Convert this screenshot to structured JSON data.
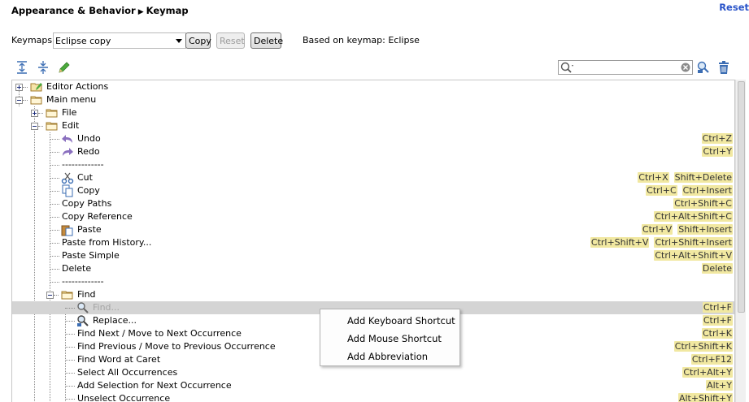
{
  "breadcrumb": {
    "parent": "Appearance & Behavior",
    "current": "Keymap"
  },
  "reset_label": "Reset",
  "keymap": {
    "label": "Keymaps:",
    "selected": "Eclipse copy",
    "copy_label": "Copy",
    "reset_label": "Reset",
    "delete_label": "Delete",
    "based_on": "Based on keymap: Eclipse"
  },
  "search": {
    "value": ""
  },
  "tree": [
    {
      "label": "Editor Actions",
      "depth": 0,
      "icon": "editor-actions-icon",
      "toggle": "plus",
      "shortcuts": []
    },
    {
      "label": "Main menu",
      "depth": 0,
      "icon": "folder-icon",
      "toggle": "minus",
      "shortcuts": []
    },
    {
      "label": "File",
      "depth": 1,
      "icon": "folder-icon",
      "toggle": "plus",
      "shortcuts": []
    },
    {
      "label": "Edit",
      "depth": 1,
      "icon": "folder-icon",
      "toggle": "minus",
      "shortcuts": []
    },
    {
      "label": "Undo",
      "depth": 2,
      "icon": "undo-icon",
      "shortcuts": [
        "Ctrl+Z"
      ]
    },
    {
      "label": "Redo",
      "depth": 2,
      "icon": "redo-icon",
      "shortcuts": [
        "Ctrl+Y"
      ]
    },
    {
      "label": "-------------",
      "depth": 2,
      "icon": "",
      "shortcuts": []
    },
    {
      "label": "Cut",
      "depth": 2,
      "icon": "scissors-icon",
      "shortcuts": [
        "Ctrl+X",
        "Shift+Delete"
      ]
    },
    {
      "label": "Copy",
      "depth": 2,
      "icon": "copy-icon",
      "shortcuts": [
        "Ctrl+C",
        "Ctrl+Insert"
      ]
    },
    {
      "label": "Copy Paths",
      "depth": 2,
      "icon": "",
      "shortcuts": [
        "Ctrl+Shift+C"
      ]
    },
    {
      "label": "Copy Reference",
      "depth": 2,
      "icon": "",
      "shortcuts": [
        "Ctrl+Alt+Shift+C"
      ]
    },
    {
      "label": "Paste",
      "depth": 2,
      "icon": "paste-icon",
      "shortcuts": [
        "Ctrl+V",
        "Shift+Insert"
      ]
    },
    {
      "label": "Paste from History...",
      "depth": 2,
      "icon": "",
      "shortcuts": [
        "Ctrl+Shift+V",
        "Ctrl+Shift+Insert"
      ]
    },
    {
      "label": "Paste Simple",
      "depth": 2,
      "icon": "",
      "shortcuts": [
        "Ctrl+Alt+Shift+V"
      ]
    },
    {
      "label": "Delete",
      "depth": 2,
      "icon": "",
      "shortcuts": [
        "Delete"
      ]
    },
    {
      "label": "-------------",
      "depth": 2,
      "icon": "",
      "shortcuts": []
    },
    {
      "label": "Find",
      "depth": 2,
      "icon": "folder-icon",
      "toggle": "minus",
      "shortcuts": []
    },
    {
      "label": "Find...",
      "depth": 3,
      "icon": "find-icon",
      "shortcuts": [
        "Ctrl+F"
      ],
      "selected": true
    },
    {
      "label": "Replace...",
      "depth": 3,
      "icon": "replace-icon",
      "shortcuts": [
        "Ctrl+F"
      ]
    },
    {
      "label": "Find Next / Move to Next Occurrence",
      "depth": 3,
      "icon": "",
      "shortcuts": [
        "Ctrl+K"
      ]
    },
    {
      "label": "Find Previous / Move to Previous Occurrence",
      "depth": 3,
      "icon": "",
      "shortcuts": [
        "Ctrl+Shift+K"
      ]
    },
    {
      "label": "Find Word at Caret",
      "depth": 3,
      "icon": "",
      "shortcuts": [
        "Ctrl+F12"
      ]
    },
    {
      "label": "Select All Occurrences",
      "depth": 3,
      "icon": "",
      "shortcuts": [
        "Ctrl+Alt+Y"
      ]
    },
    {
      "label": "Add Selection for Next Occurrence",
      "depth": 3,
      "icon": "",
      "shortcuts": [
        "Alt+Y"
      ]
    },
    {
      "label": "Unselect Occurrence",
      "depth": 3,
      "icon": "",
      "shortcuts": [
        "Alt+Shift+Y"
      ]
    }
  ],
  "context_menu": [
    "Add Keyboard Shortcut",
    "Add Mouse Shortcut",
    "Add Abbreviation"
  ],
  "colors": {
    "shortcut_bg": "#f1e8a1",
    "selection": "#d4d4d4",
    "link": "#2a54c9"
  }
}
